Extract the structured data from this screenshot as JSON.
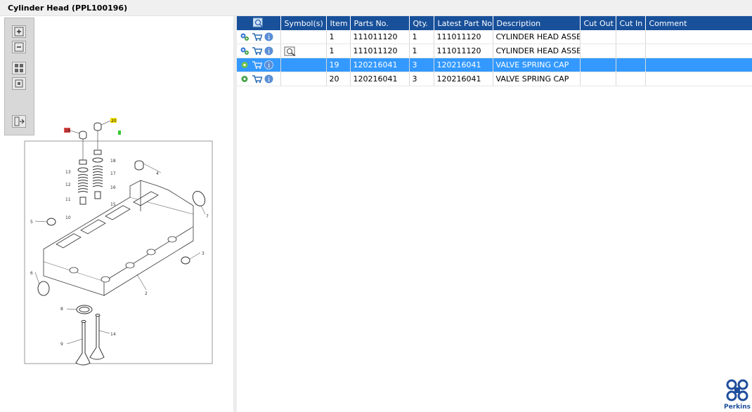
{
  "window": {
    "title": "Cylinder Head (PPL100196)"
  },
  "toolbar": {
    "buttons": [
      {
        "name": "zoom-in",
        "icon": "plus-icon"
      },
      {
        "name": "zoom-out",
        "icon": "minus-icon"
      },
      {
        "name": "fit-all",
        "icon": "grid-icon"
      },
      {
        "name": "fit-window",
        "icon": "square-icon"
      },
      {
        "name": "export",
        "icon": "export-icon"
      }
    ]
  },
  "drawing": {
    "callouts": [
      "1",
      "2",
      "3",
      "4",
      "5",
      "6",
      "7",
      "8",
      "9",
      "10",
      "11",
      "12",
      "13",
      "14",
      "15",
      "16",
      "17",
      "18",
      "19",
      "20"
    ],
    "highlight_19": "19",
    "highlight_20": "20"
  },
  "table": {
    "headers": {
      "actions": "",
      "symbols": "Symbol(s)",
      "item": "Item",
      "parts_no": "Parts No.",
      "qty": "Qty.",
      "latest_part_no": "Latest Part No.",
      "description": "Description",
      "cut_out": "Cut Out",
      "cut_in": "Cut In",
      "comment": "Comment"
    },
    "rows": [
      {
        "item": "1",
        "parts_no": "111011120",
        "qty": "1",
        "latest_part_no": "111011120",
        "description": "CYLINDER HEAD ASSEM",
        "cut_out": "",
        "cut_in": "",
        "comment": ""
      },
      {
        "item": "1",
        "parts_no": "111011120",
        "qty": "1",
        "latest_part_no": "111011120",
        "description": "CYLINDER HEAD ASSEM",
        "cut_out": "",
        "cut_in": "",
        "comment": ""
      },
      {
        "item": "19",
        "parts_no": "120216041",
        "qty": "3",
        "latest_part_no": "120216041",
        "description": "VALVE SPRING CAP",
        "cut_out": "",
        "cut_in": "",
        "comment": ""
      },
      {
        "item": "20",
        "parts_no": "120216041",
        "qty": "3",
        "latest_part_no": "120216041",
        "description": "VALVE SPRING CAP",
        "cut_out": "",
        "cut_in": "",
        "comment": ""
      }
    ]
  },
  "brand": {
    "name": "Perkins",
    "color": "#1f4e9c"
  },
  "colors": {
    "header": "#18509a",
    "selected": "#3399ff"
  }
}
